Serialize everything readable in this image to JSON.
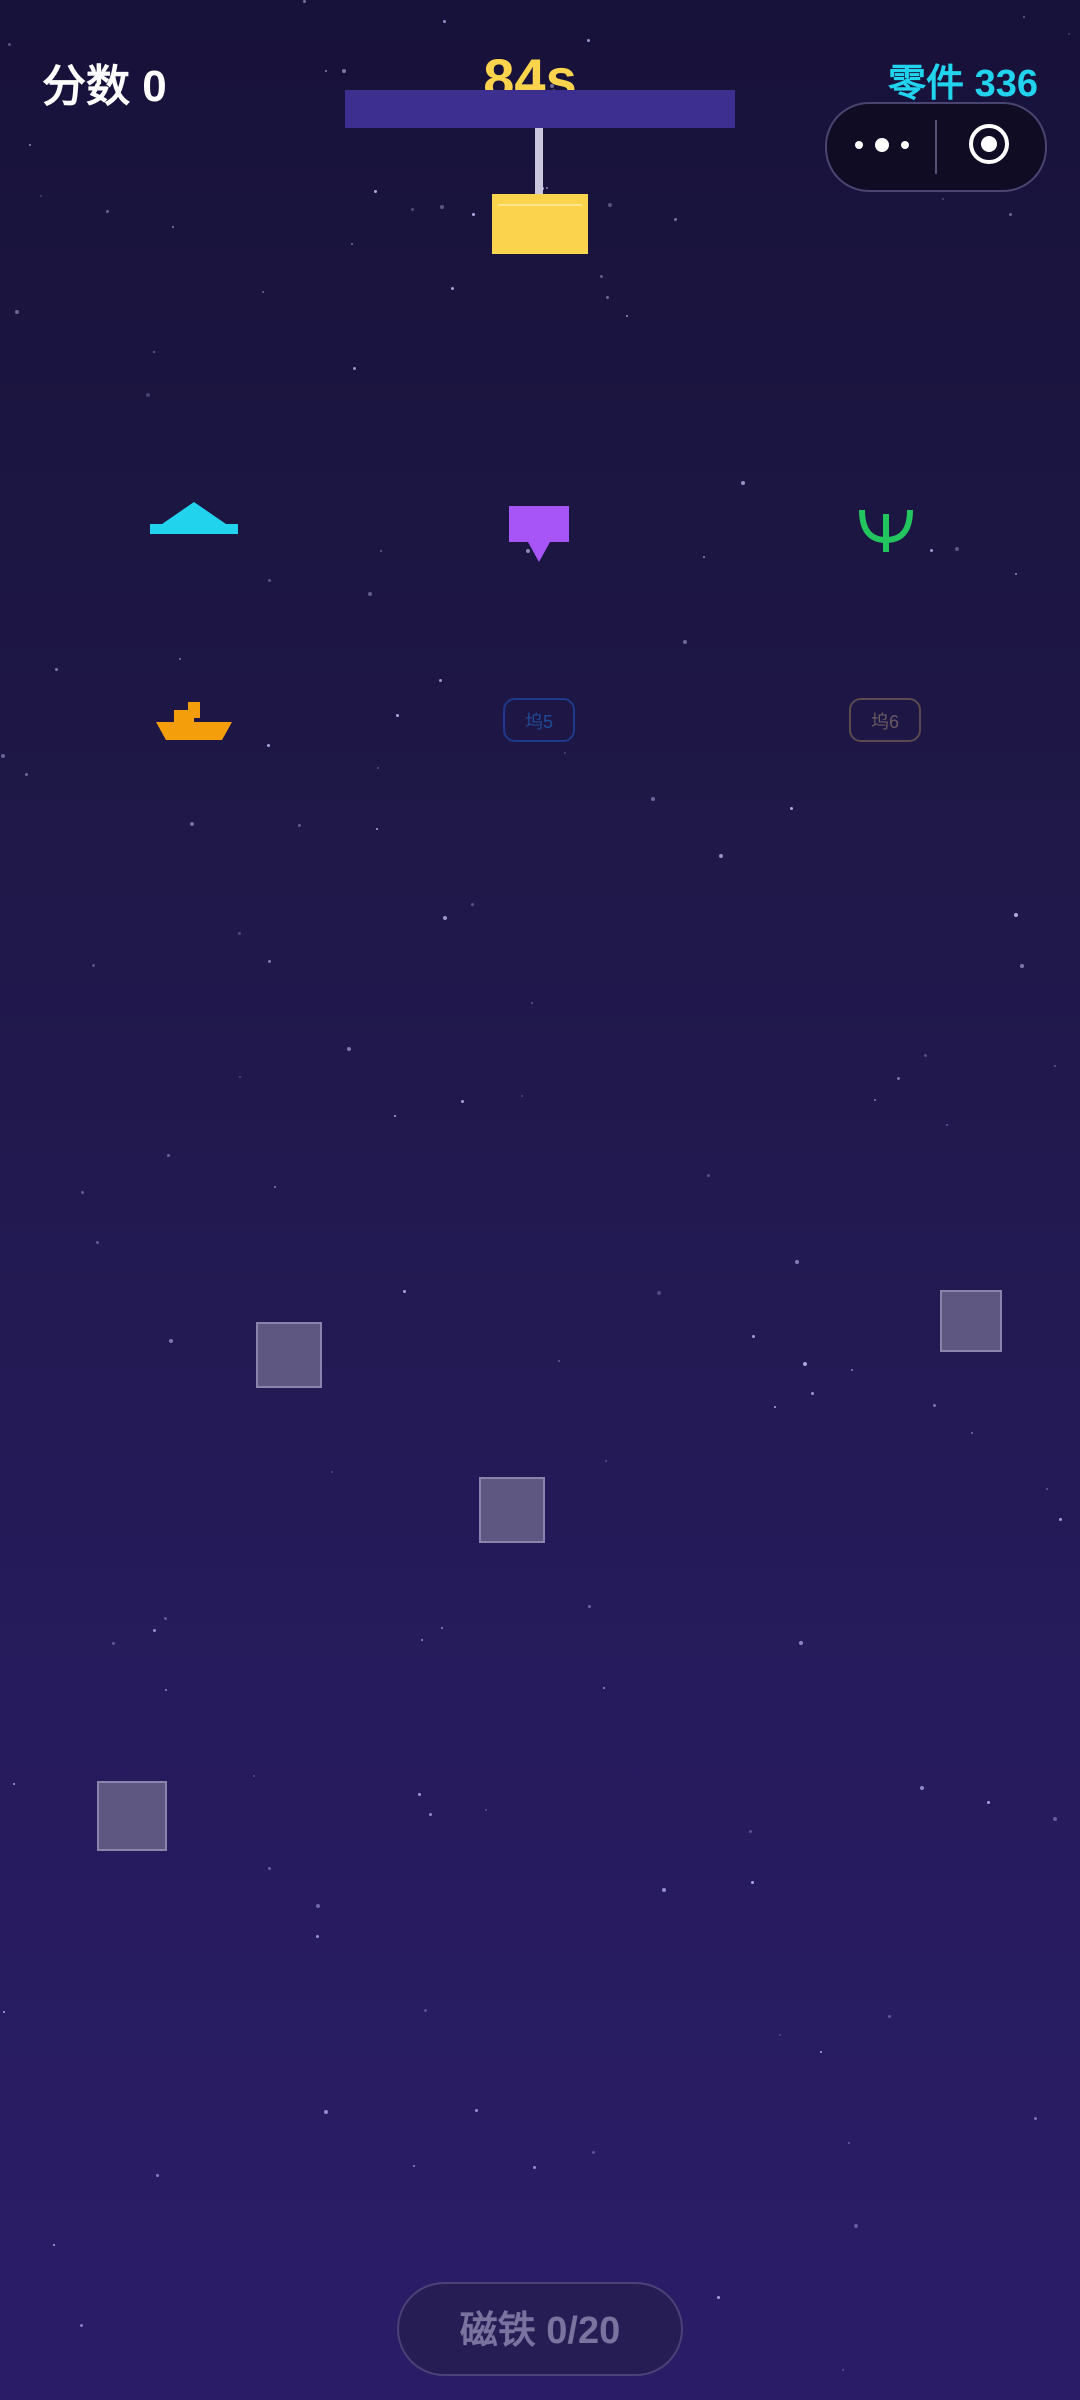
{
  "hud": {
    "score_label": "分数 0",
    "timer_label": "84s",
    "parts_label": "零件 336"
  },
  "docks": [
    {
      "name": "dock-1",
      "state": "filled",
      "icon": "spaceship-wing-icon",
      "color": "#22d3ee"
    },
    {
      "name": "dock-2",
      "state": "filled",
      "icon": "shield-banner-icon",
      "color": "#a855f7"
    },
    {
      "name": "dock-3",
      "state": "filled",
      "icon": "trident-icon",
      "color": "#22c55e"
    },
    {
      "name": "dock-4",
      "state": "filled",
      "icon": "boat-icon",
      "color": "#f59e0b"
    },
    {
      "name": "dock-5",
      "state": "empty",
      "label": "坞5",
      "color": "#1e3a8a"
    },
    {
      "name": "dock-6",
      "state": "empty",
      "label": "坞6",
      "color": "#5b4a50"
    }
  ],
  "magnet_button": {
    "label": "磁铁 0/20"
  },
  "colors": {
    "accent_timer": "#fcd34d",
    "accent_parts": "#22d3ee",
    "background": "#1f1848"
  }
}
